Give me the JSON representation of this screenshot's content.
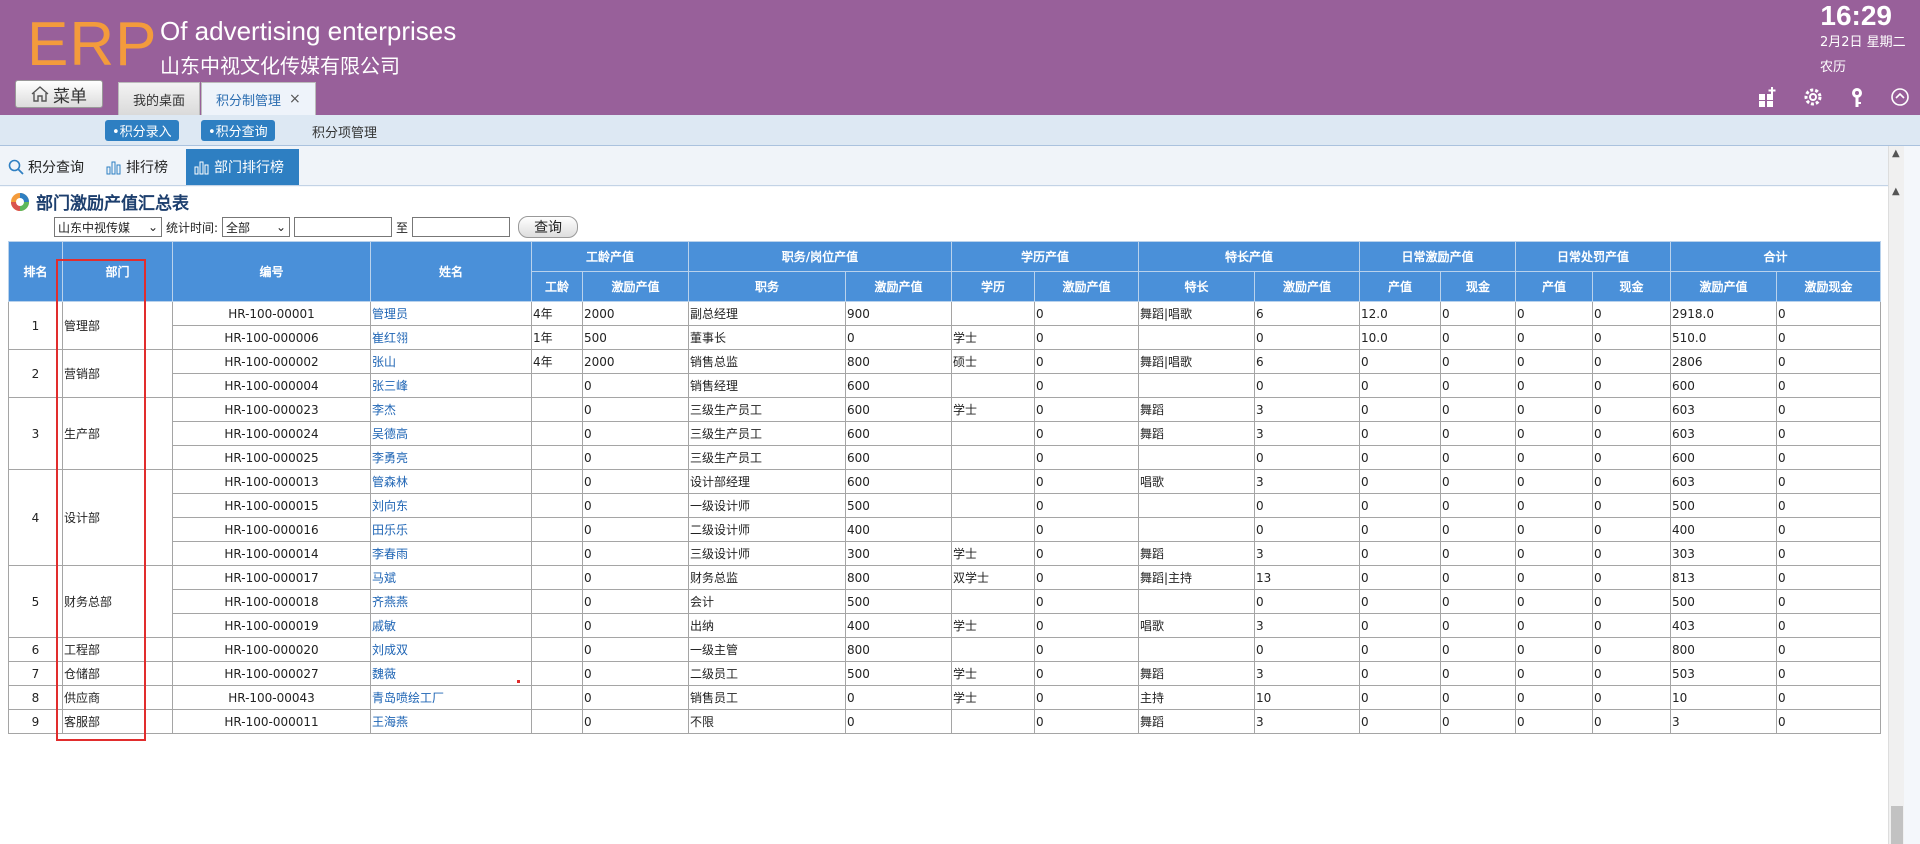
{
  "header": {
    "logo": "ERP",
    "english_title": "Of advertising enterprises",
    "company": "山东中视文化传媒有限公司",
    "time": "16:29",
    "date": "2月2日 星期二",
    "lunar": "农历",
    "menu_label": "菜单",
    "tabs": [
      {
        "label": "我的桌面"
      },
      {
        "label": "积分制管理",
        "close": "×"
      }
    ]
  },
  "subnav": {
    "entry": "•积分录入",
    "query": "•积分查询",
    "items": "积分项管理"
  },
  "page_tabs": {
    "query": "积分查询",
    "rank": "排行榜",
    "dept": "部门排行榜"
  },
  "report": {
    "title": "部门激励产值汇总表",
    "company_select": "山东中视传媒",
    "time_label": "统计时间:",
    "time_select": "全部",
    "to_label": "至",
    "query_button": "查询"
  },
  "table": {
    "groups": {
      "rank": "排名",
      "dept": "部门",
      "code": "编号",
      "name": "姓名",
      "seniority": "工龄产值",
      "position": "职务/岗位产值",
      "education": "学历产值",
      "specialty": "特长产值",
      "daily_reward": "日常激励产值",
      "daily_penalty": "日常处罚产值",
      "total": "合计"
    },
    "subs": {
      "s1": "工龄",
      "s2": "激励产值",
      "s3": "职务",
      "s4": "激励产值",
      "s5": "学历",
      "s6": "激励产值",
      "s7": "特长",
      "s8": "激励产值",
      "s9": "产值",
      "s10": "现金",
      "s11": "产值",
      "s12": "现金",
      "s13": "激励产值",
      "s14": "激励现金"
    },
    "departments": [
      {
        "rank": "1",
        "name": "管理部",
        "employees": [
          [
            "HR-100-00001",
            "管理员",
            "4年",
            "2000",
            "副总经理",
            "900",
            "",
            "0",
            "舞蹈|唱歌",
            "6",
            "12.0",
            "0",
            "0",
            "0",
            "2918.0",
            "0"
          ],
          [
            "HR-100-000006",
            "崔红翎",
            "1年",
            "500",
            "董事长",
            "0",
            "学士",
            "0",
            "",
            "0",
            "10.0",
            "0",
            "0",
            "0",
            "510.0",
            "0"
          ]
        ]
      },
      {
        "rank": "2",
        "name": "营销部",
        "employees": [
          [
            "HR-100-000002",
            "张山",
            "4年",
            "2000",
            "销售总监",
            "800",
            "硕士",
            "0",
            "舞蹈|唱歌",
            "6",
            "0",
            "0",
            "0",
            "0",
            "2806",
            "0"
          ],
          [
            "HR-100-000004",
            "张三峰",
            "",
            "0",
            "销售经理",
            "600",
            "",
            "0",
            "",
            "0",
            "0",
            "0",
            "0",
            "0",
            "600",
            "0"
          ]
        ]
      },
      {
        "rank": "3",
        "name": "生产部",
        "employees": [
          [
            "HR-100-000023",
            "李杰",
            "",
            "0",
            "三级生产员工",
            "600",
            "学士",
            "0",
            "舞蹈",
            "3",
            "0",
            "0",
            "0",
            "0",
            "603",
            "0"
          ],
          [
            "HR-100-000024",
            "吴德高",
            "",
            "0",
            "三级生产员工",
            "600",
            "",
            "0",
            "舞蹈",
            "3",
            "0",
            "0",
            "0",
            "0",
            "603",
            "0"
          ],
          [
            "HR-100-000025",
            "李勇亮",
            "",
            "0",
            "三级生产员工",
            "600",
            "",
            "0",
            "",
            "0",
            "0",
            "0",
            "0",
            "0",
            "600",
            "0"
          ]
        ]
      },
      {
        "rank": "4",
        "name": "设计部",
        "employees": [
          [
            "HR-100-000013",
            "管森林",
            "",
            "0",
            "设计部经理",
            "600",
            "",
            "0",
            "唱歌",
            "3",
            "0",
            "0",
            "0",
            "0",
            "603",
            "0"
          ],
          [
            "HR-100-000015",
            "刘向东",
            "",
            "0",
            "一级设计师",
            "500",
            "",
            "0",
            "",
            "0",
            "0",
            "0",
            "0",
            "0",
            "500",
            "0"
          ],
          [
            "HR-100-000016",
            "田乐乐",
            "",
            "0",
            "二级设计师",
            "400",
            "",
            "0",
            "",
            "0",
            "0",
            "0",
            "0",
            "0",
            "400",
            "0"
          ],
          [
            "HR-100-000014",
            "李春雨",
            "",
            "0",
            "三级设计师",
            "300",
            "学士",
            "0",
            "舞蹈",
            "3",
            "0",
            "0",
            "0",
            "0",
            "303",
            "0"
          ]
        ]
      },
      {
        "rank": "5",
        "name": "财务总部",
        "employees": [
          [
            "HR-100-000017",
            "马斌",
            "",
            "0",
            "财务总监",
            "800",
            "双学士",
            "0",
            "舞蹈|主持",
            "13",
            "0",
            "0",
            "0",
            "0",
            "813",
            "0"
          ],
          [
            "HR-100-000018",
            "齐燕燕",
            "",
            "0",
            "会计",
            "500",
            "",
            "0",
            "",
            "0",
            "0",
            "0",
            "0",
            "0",
            "500",
            "0"
          ],
          [
            "HR-100-000019",
            "戚敏",
            "",
            "0",
            "出纳",
            "400",
            "学士",
            "0",
            "唱歌",
            "3",
            "0",
            "0",
            "0",
            "0",
            "403",
            "0"
          ]
        ]
      },
      {
        "rank": "6",
        "name": "工程部",
        "employees": [
          [
            "HR-100-000020",
            "刘成双",
            "",
            "0",
            "一级主管",
            "800",
            "",
            "0",
            "",
            "0",
            "0",
            "0",
            "0",
            "0",
            "800",
            "0"
          ]
        ]
      },
      {
        "rank": "7",
        "name": "仓储部",
        "employees": [
          [
            "HR-100-000027",
            "魏薇",
            "",
            "0",
            "二级员工",
            "500",
            "学士",
            "0",
            "舞蹈",
            "3",
            "0",
            "0",
            "0",
            "0",
            "503",
            "0"
          ]
        ]
      },
      {
        "rank": "8",
        "name": "供应商",
        "employees": [
          [
            "HR-100-00043",
            "青岛喷绘工厂",
            "",
            "0",
            "销售员工",
            "0",
            "学士",
            "0",
            "主持",
            "10",
            "0",
            "0",
            "0",
            "0",
            "10",
            "0"
          ]
        ]
      },
      {
        "rank": "9",
        "name": "客服部",
        "employees": [
          [
            "HR-100-000011",
            "王海燕",
            "",
            "0",
            "不限",
            "0",
            "",
            "0",
            "舞蹈",
            "3",
            "0",
            "0",
            "0",
            "0",
            "3",
            "0"
          ]
        ]
      }
    ]
  },
  "colors": {
    "header_bg": "#98609a",
    "logo": "#f39b3c",
    "accent": "#2e7fc2",
    "table_header": "#4a90d9",
    "highlight_box": "#e12d2d"
  }
}
